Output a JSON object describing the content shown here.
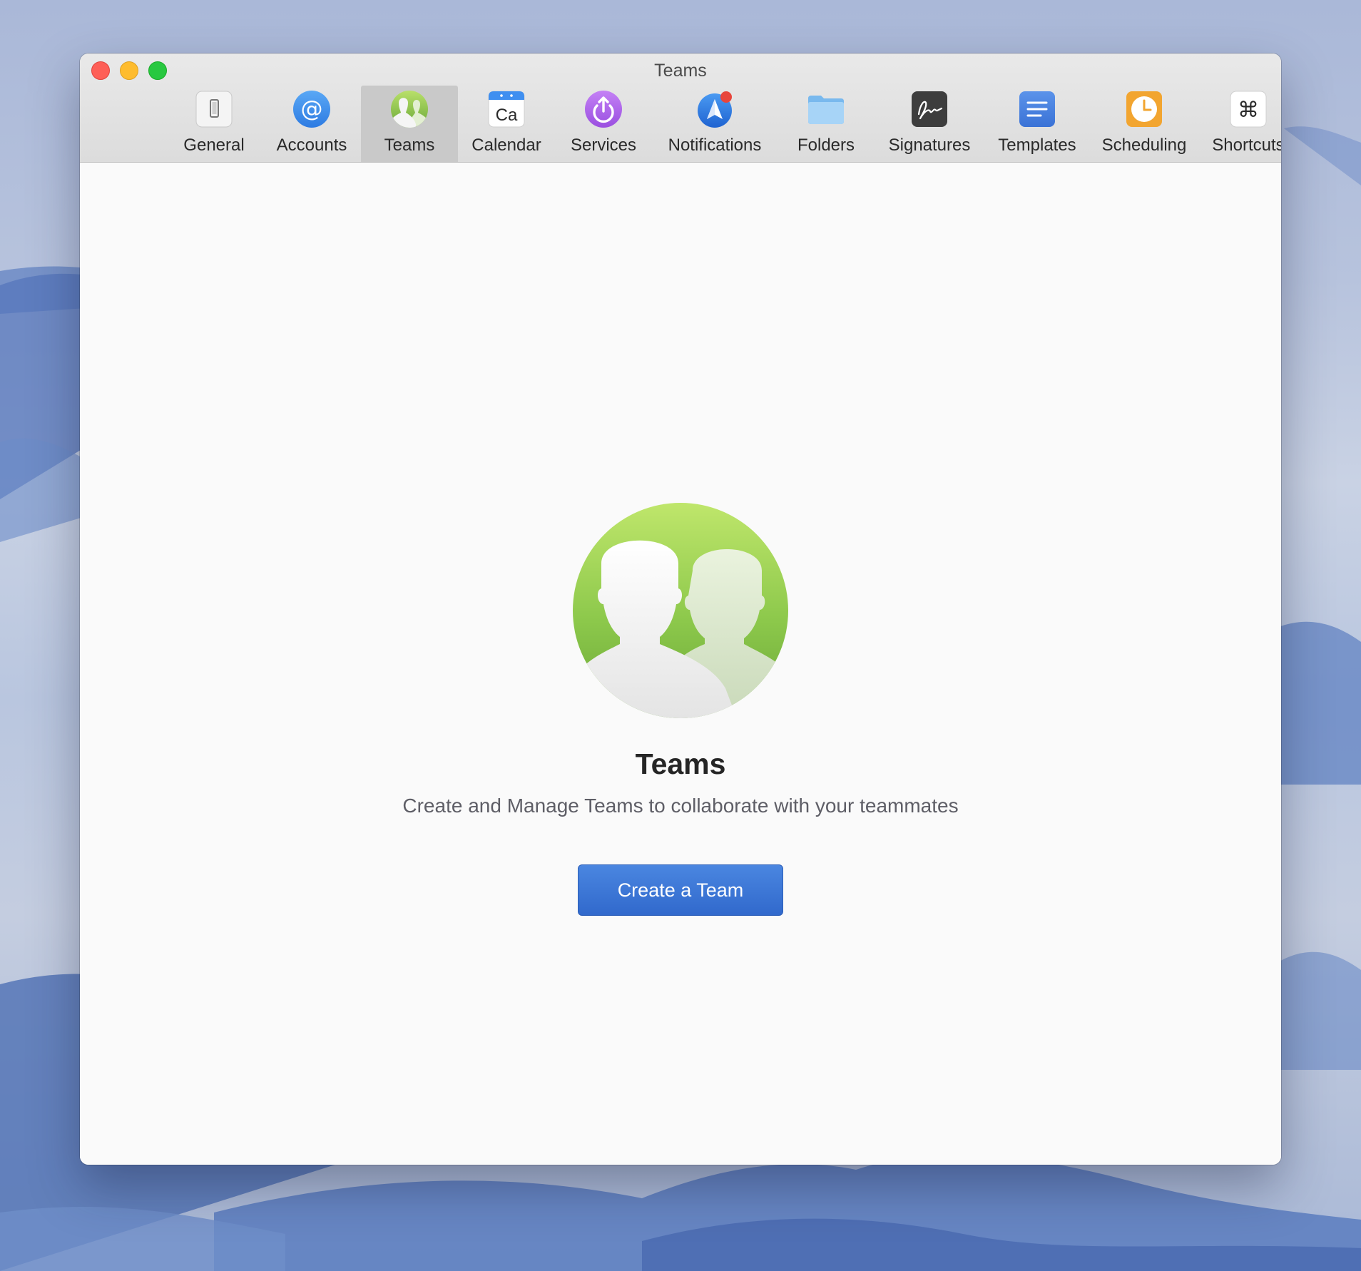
{
  "window": {
    "title": "Teams"
  },
  "toolbar": {
    "items": [
      {
        "label": "General",
        "icon": "phone-toggle-icon"
      },
      {
        "label": "Accounts",
        "icon": "at-sign-icon"
      },
      {
        "label": "Teams",
        "icon": "teams-people-icon",
        "selected": true
      },
      {
        "label": "Calendar",
        "icon": "calendar-icon",
        "icon_text": "Ca"
      },
      {
        "label": "Services",
        "icon": "power-arrow-icon"
      },
      {
        "label": "Notifications",
        "icon": "notification-plane-icon"
      },
      {
        "label": "Folders",
        "icon": "folder-icon"
      },
      {
        "label": "Signatures",
        "icon": "signature-icon"
      },
      {
        "label": "Templates",
        "icon": "template-lines-icon"
      },
      {
        "label": "Scheduling",
        "icon": "clock-icon"
      },
      {
        "label": "Shortcuts",
        "icon": "command-key-icon",
        "icon_text": "⌘"
      }
    ]
  },
  "main": {
    "title": "Teams",
    "subtitle": "Create and Manage Teams to collaborate with your teammates",
    "create_button_label": "Create a Team"
  },
  "colors": {
    "accent_button": "#3a76d8",
    "teams_green": "#7cbf45",
    "notification_badge": "#e8453c"
  }
}
